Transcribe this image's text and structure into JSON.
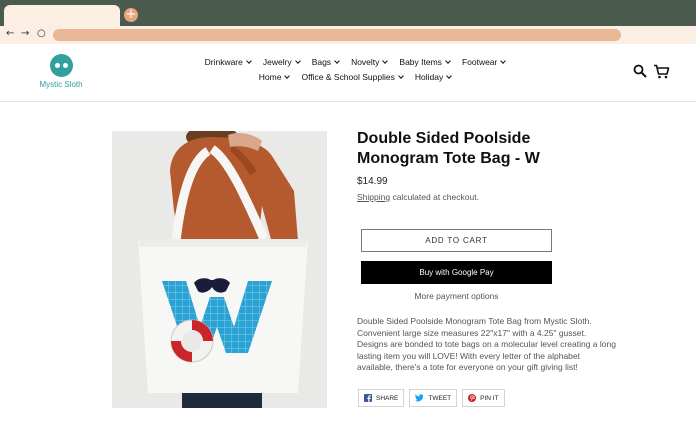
{
  "browser": {
    "new_tab_glyph": "+",
    "back_glyph": "←",
    "forward_glyph": "→",
    "reload_glyph": "○"
  },
  "store": {
    "logo_text": "Mystic Sloth",
    "brand_color": "#2e9e9e"
  },
  "nav": {
    "row1": [
      "Drinkware",
      "Jewelry",
      "Bags",
      "Novelty",
      "Baby Items",
      "Footwear"
    ],
    "row2": [
      "Home",
      "Office & School Supplies",
      "Holiday"
    ]
  },
  "product": {
    "title": "Double Sided Poolside Monogram Tote Bag - W",
    "price": "$14.99",
    "shipping_link": "Shipping",
    "shipping_suffix": " calculated at checkout.",
    "add_to_cart": "ADD TO CART",
    "buy_button": "Buy with Google Pay",
    "more_payment": "More payment options",
    "description": "Double Sided Poolside Monogram Tote Bag from Mystic Sloth. Convenient large size measures 22\"x17\" with a 4.25\" gusset. Designs are bonded to tote bags on a molecular level creating a long lasting item you will LOVE! With every letter of the alphabet available, there's a tote for everyone on your gift giving list!",
    "monogram_letter": "W"
  },
  "share": {
    "share_label": "SHARE",
    "tweet_label": "TWEET",
    "pin_label": "PIN IT"
  }
}
